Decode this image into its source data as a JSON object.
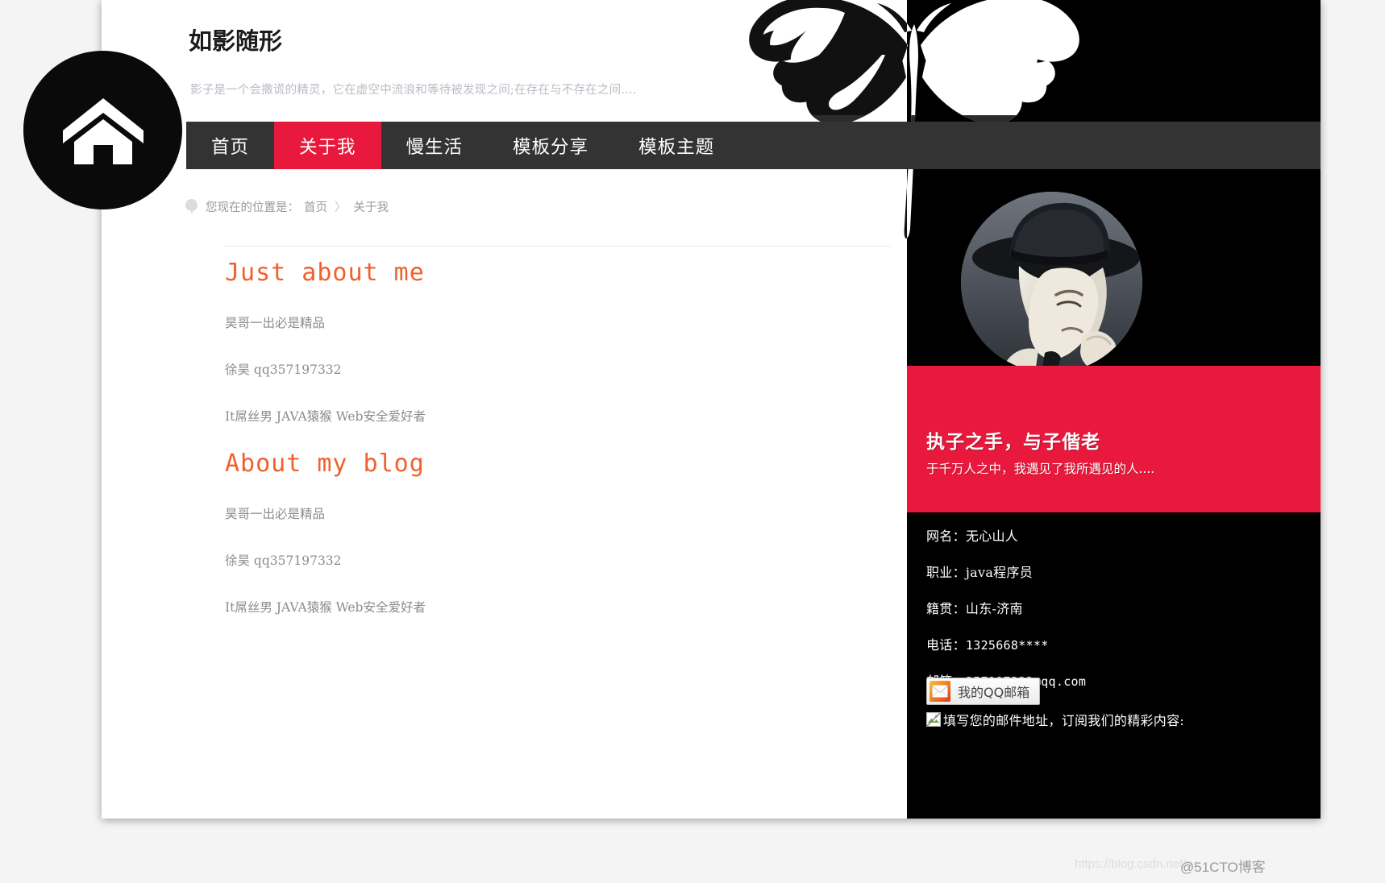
{
  "site": {
    "title": "如影随形",
    "tagline": "影子是一个会撒谎的精灵，它在虚空中流浪和等待被发现之间;在存在与不存在之间...."
  },
  "nav": {
    "items": [
      {
        "label": "首页",
        "active": false
      },
      {
        "label": "关于我",
        "active": true
      },
      {
        "label": "慢生活",
        "active": false
      },
      {
        "label": "模板分享",
        "active": false
      },
      {
        "label": "模板主题",
        "active": false
      }
    ]
  },
  "breadcrumb": {
    "icon": "location-pin-icon",
    "prefix": "您现在的位置是：",
    "items": [
      "首页",
      "关于我"
    ],
    "separator": "〉"
  },
  "article": {
    "sections": [
      {
        "heading": "Just about me",
        "paragraphs": [
          "昊哥一出必是精品",
          "徐昊 qq357197332",
          "It屌丝男 JAVA猿猴 Web安全爱好者"
        ]
      },
      {
        "heading": "About my blog",
        "paragraphs": [
          "昊哥一出必是精品",
          "徐昊 qq357197332",
          "It屌丝男 JAVA猿猴 Web安全爱好者"
        ]
      }
    ]
  },
  "sidebar": {
    "avatar_alt": "woman-with-hat-avatar",
    "quote": {
      "title": "执子之手，与子偕老",
      "subtitle": "于千万人之中，我遇见了我所遇见的人...."
    },
    "info": [
      {
        "label": "网名：",
        "value": "无心山人",
        "mono": false
      },
      {
        "label": "职业：",
        "value": "java程序员",
        "mono": false
      },
      {
        "label": "籍贯：",
        "value": "山东-济南",
        "mono": false
      },
      {
        "label": "电话：",
        "value": "1325668****",
        "mono": true
      },
      {
        "label": "邮箱：",
        "value": "357197332@qq.com",
        "mono": true
      }
    ],
    "qq_button": {
      "label": "我的QQ邮箱",
      "icon": "mail-envelope-icon"
    },
    "subscribe": {
      "icon": "broken-image-icon",
      "text": "填写您的邮件地址，订阅我们的精彩内容:"
    }
  },
  "home_button": {
    "icon": "home-icon"
  },
  "watermarks": {
    "csdn": "https://blog.csdn.net/ru",
    "cto": "@51CTO博客"
  },
  "colors": {
    "accent_red": "#e8193c",
    "nav_bg": "#333333",
    "heading_orange": "#f1602d",
    "page_bg": "#f4f4f4",
    "sidebar_bg": "#000000"
  }
}
